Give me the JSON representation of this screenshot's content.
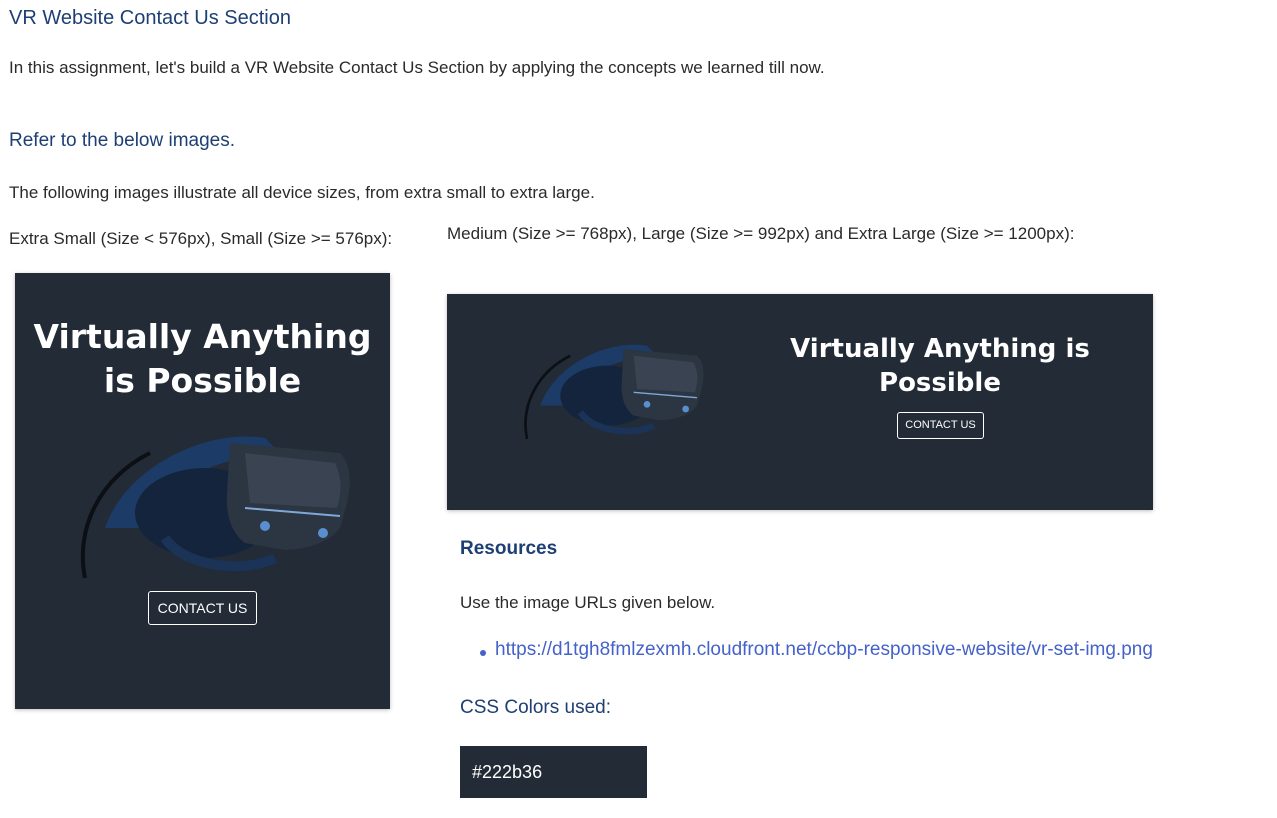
{
  "assignment": {
    "title": "VR Website Contact Us Section",
    "intro": "In this assignment, let's build a VR Website Contact Us Section by applying the concepts we learned till now.",
    "refer_heading": "Refer to the below images.",
    "device_note": "The following images illustrate all device sizes, from extra small to extra large."
  },
  "small_preview": {
    "caption": "Extra Small (Size < 576px), Small (Size >= 576px):",
    "heading_line1": "Virtually Anything",
    "heading_line2": "is Possible",
    "button_label": "CONTACT US",
    "image_icon": "vr-headset-icon"
  },
  "large_preview": {
    "caption": "Medium (Size >= 768px), Large (Size >= 992px) and Extra Large (Size >= 1200px):",
    "heading_line1": "Virtually Anything is",
    "heading_line2": "Possible",
    "button_label": "CONTACT US",
    "image_icon": "vr-headset-icon"
  },
  "resources": {
    "heading": "Resources",
    "description": "Use the image URLs given below.",
    "links": [
      "https://d1tgh8fmlzexmh.cloudfront.net/ccbp-responsive-website/vr-set-img.png"
    ]
  },
  "css_colors": {
    "heading": "CSS Colors used:",
    "swatches": [
      "#222b36"
    ]
  },
  "colors": {
    "background": "#222b36",
    "heading": "#1e3f74",
    "link": "#4462c9"
  }
}
